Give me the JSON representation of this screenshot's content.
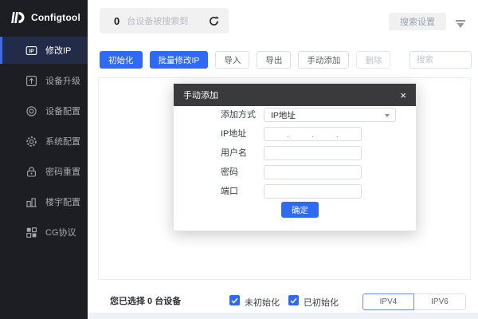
{
  "app": {
    "name": "Configtool"
  },
  "sidebar": {
    "items": [
      {
        "label": "修改IP",
        "icon": "ip-icon",
        "active": true
      },
      {
        "label": "设备升级",
        "icon": "device-upgrade-icon",
        "active": false
      },
      {
        "label": "设备配置",
        "icon": "device-config-icon",
        "active": false
      },
      {
        "label": "系统配置",
        "icon": "system-config-icon",
        "active": false
      },
      {
        "label": "密码重置",
        "icon": "password-reset-icon",
        "active": false
      },
      {
        "label": "楼宇配置",
        "icon": "building-config-icon",
        "active": false
      },
      {
        "label": "CG协议",
        "icon": "cg-protocol-icon",
        "active": false
      }
    ]
  },
  "topbar": {
    "device_count": "0",
    "device_count_text": "台设备被搜索到",
    "refresh_icon": "refresh-icon",
    "search_settings_label": "搜索设置",
    "filter_icon": "filter-collapse-icon"
  },
  "toolbar": {
    "buttons": [
      {
        "label": "初始化",
        "style": "primary"
      },
      {
        "label": "批量修改IP",
        "style": "primary"
      },
      {
        "label": "导入",
        "style": "plain"
      },
      {
        "label": "导出",
        "style": "plain"
      },
      {
        "label": "手动添加",
        "style": "plain"
      },
      {
        "label": "删除",
        "style": "disabled"
      }
    ],
    "search_placeholder": "搜索"
  },
  "modal": {
    "title": "手动添加",
    "close_label": "×",
    "fields": [
      {
        "label": "添加方式",
        "type": "select",
        "value": "IP地址"
      },
      {
        "label": "IP地址",
        "type": "ip-segmented",
        "value": ""
      },
      {
        "label": "用户名",
        "type": "text",
        "value": ""
      },
      {
        "label": "密码",
        "type": "password",
        "value": ""
      },
      {
        "label": "端口",
        "type": "text",
        "value": ""
      }
    ],
    "ip_separator": ".",
    "confirm_label": "确定"
  },
  "footer": {
    "selection_text": "您已选择 0 台设备",
    "filters": [
      {
        "label": "未初始化",
        "checked": true
      },
      {
        "label": "已初始化",
        "checked": true
      }
    ],
    "ip_version_buttons": [
      {
        "label": "IPV4",
        "active": true
      },
      {
        "label": "IPV6",
        "active": false
      }
    ]
  },
  "colors": {
    "accent": "#2d6af7",
    "sidebar_bg": "#1d1e23",
    "sidebar_active_bg": "#222c49",
    "modal_header_bg": "#3a3a3c",
    "checkbox_checked": "#2d6af7"
  }
}
